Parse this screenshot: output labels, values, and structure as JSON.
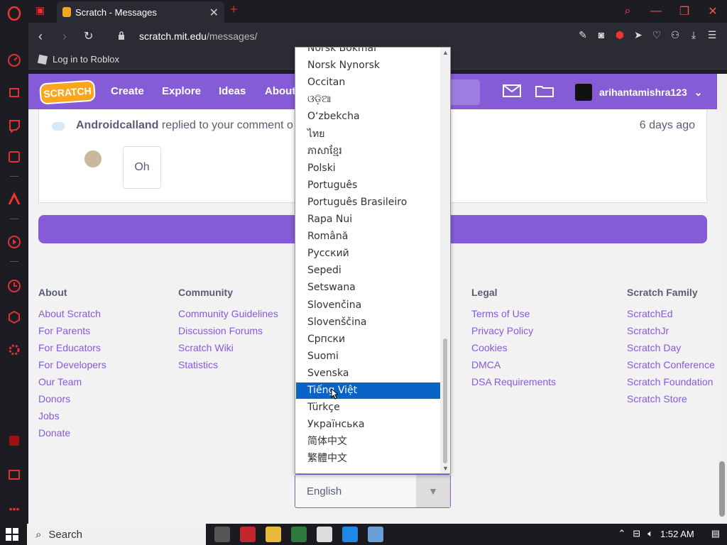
{
  "browser": {
    "tab_title": "Scratch - Messages",
    "url_host": "scratch.mit.edu",
    "url_path": "/messages/",
    "bookmark": "Log in to Roblox"
  },
  "header": {
    "nav": [
      "Create",
      "Explore",
      "Ideas",
      "About"
    ],
    "logo": "SCRATCH",
    "username": "arihantamishra123"
  },
  "message": {
    "user": "Androidcalland",
    "text": "replied to your comment o",
    "ago": "6 days ago",
    "reply": "Oh"
  },
  "footer": {
    "about": {
      "heading": "About",
      "links": [
        "About Scratch",
        "For Parents",
        "For Educators",
        "For Developers",
        "Our Team",
        "Donors",
        "Jobs",
        "Donate"
      ]
    },
    "community": {
      "heading": "Community",
      "links": [
        "Community Guidelines",
        "Discussion Forums",
        "Scratch Wiki",
        "Statistics"
      ]
    },
    "legal": {
      "heading": "Legal",
      "links": [
        "Terms of Use",
        "Privacy Policy",
        "Cookies",
        "DMCA",
        "DSA Requirements"
      ]
    },
    "family": {
      "heading": "Scratch Family",
      "links": [
        "ScratchEd",
        "ScratchJr",
        "Scratch Day",
        "Scratch Conference",
        "Scratch Foundation",
        "Scratch Store"
      ]
    }
  },
  "language": {
    "selected": "English",
    "highlighted": "Tiếng Việt",
    "options": [
      "Norsk Bokmål",
      "Norsk Nynorsk",
      "Occitan",
      "ଓଡ଼ିଆ",
      "Oʻzbekcha",
      "ไทย",
      "ភាសាខ្មែរ",
      "Polski",
      "Português",
      "Português Brasileiro",
      "Rapa Nui",
      "Română",
      "Русский",
      "Sepedi",
      "Setswana",
      "Slovenčina",
      "Slovenščina",
      "Српски",
      "Suomi",
      "Svenska",
      "Tiếng Việt",
      "Türkçe",
      "Українська",
      "简体中文",
      "繁體中文"
    ]
  },
  "taskbar": {
    "search": "Search",
    "time": "1:52 AM"
  },
  "colors": {
    "brand": "#855cd6",
    "accent": "#f9a61e",
    "selection": "#0a64c8"
  }
}
